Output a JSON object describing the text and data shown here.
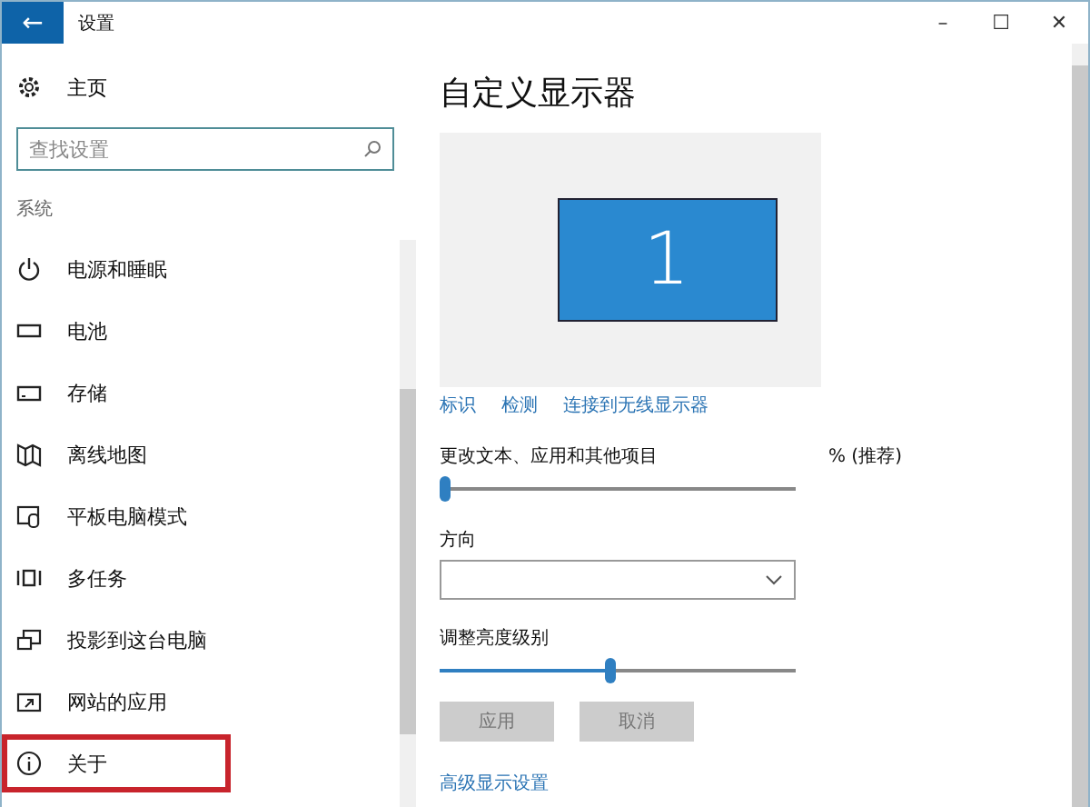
{
  "window": {
    "title": "设置",
    "back": "←",
    "controls": [
      "–",
      "☐",
      "✕"
    ]
  },
  "sidebar": {
    "home": "主页",
    "search": {
      "placeholder": "查找设置"
    },
    "section": "系统",
    "items": [
      {
        "label": "电源和睡眠",
        "kind": "power",
        "highlighted": false
      },
      {
        "label": "电池",
        "kind": "battery",
        "highlighted": false
      },
      {
        "label": "存储",
        "kind": "storage",
        "highlighted": false
      },
      {
        "label": "离线地图",
        "kind": "map",
        "highlighted": false
      },
      {
        "label": "平板电脑模式",
        "kind": "tablet",
        "highlighted": false
      },
      {
        "label": "多任务",
        "kind": "multitask",
        "highlighted": false
      },
      {
        "label": "投影到这台电脑",
        "kind": "project",
        "highlighted": false
      },
      {
        "label": "网站的应用",
        "kind": "apps",
        "highlighted": false
      },
      {
        "label": "关于",
        "kind": "about",
        "highlighted": true
      }
    ]
  },
  "main": {
    "heading": "自定义显示器",
    "monitor": "1",
    "links": [
      "标识",
      "检测",
      "连接到无线显示器"
    ],
    "scale": {
      "label": "更改文本、应用和其他项目",
      "label_tail": "% (推荐)",
      "level": 0
    },
    "orientation": {
      "label": "方向"
    },
    "brightness": {
      "label": "调整亮度级别",
      "level": 0.48
    },
    "buttons": [
      {
        "label": "应用",
        "disabled": true
      },
      {
        "label": "取消",
        "disabled": true
      }
    ],
    "advanced_link": "高级显示设置"
  }
}
